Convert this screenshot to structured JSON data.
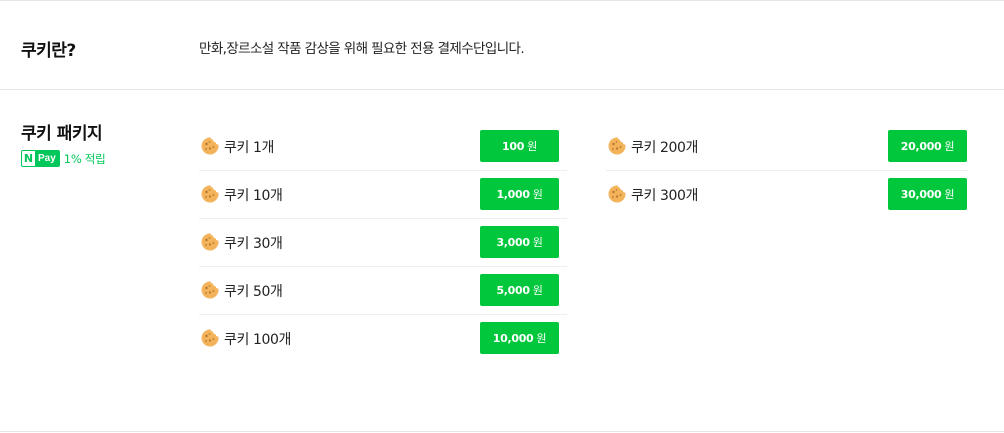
{
  "about": {
    "title": "쿠키란?",
    "description": "만화,장르소설 작품 감상을 위해 필요한 전용 결제수단입니다."
  },
  "package": {
    "title": "쿠키 패키지",
    "npay_n": "N",
    "npay_pay": "Pay",
    "npay_reward": "1% 적립"
  },
  "currency": "원",
  "items_left": [
    {
      "label": "쿠키 1개",
      "price": "100"
    },
    {
      "label": "쿠키 10개",
      "price": "1,000"
    },
    {
      "label": "쿠키 30개",
      "price": "3,000"
    },
    {
      "label": "쿠키 50개",
      "price": "5,000"
    },
    {
      "label": "쿠키 100개",
      "price": "10,000"
    }
  ],
  "items_right": [
    {
      "label": "쿠키 200개",
      "price": "20,000"
    },
    {
      "label": "쿠키 300개",
      "price": "30,000"
    }
  ],
  "colors": {
    "button": "#00c73c",
    "npay": "#03c75a",
    "cookie": "#f2b35b"
  },
  "icons": {
    "cookie": "cookie-icon",
    "npay": "naver-pay-logo"
  }
}
